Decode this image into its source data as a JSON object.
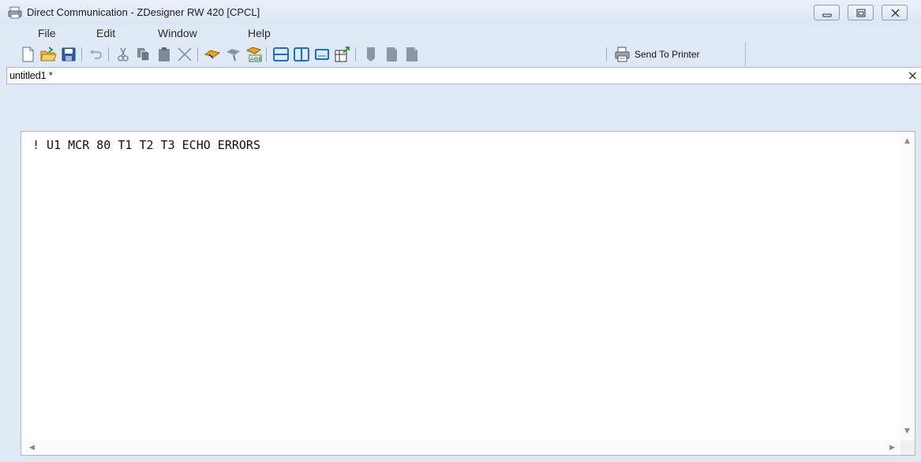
{
  "window": {
    "title": "Direct Communication - ZDesigner RW 420 [CPCL]"
  },
  "menu": {
    "items": [
      "File",
      "Edit",
      "Window",
      "Help"
    ]
  },
  "toolbar": {
    "icons": [
      "new-file-icon",
      "open-folder-icon",
      "save-icon",
      "undo-icon",
      "cut-icon",
      "copy-icon",
      "paste-icon",
      "delete-icon",
      "send-command-icon",
      "receive-icon",
      "abc-icon",
      "horizontal-split-icon",
      "vertical-split-icon",
      "single-view-icon",
      "export-icon",
      "align-top-icon",
      "align-bottom-icon",
      "align-page-icon",
      "printer-icon"
    ],
    "send_label": "Send To Printer"
  },
  "tab": {
    "label": "untitled1 *",
    "close_glyph": "×"
  },
  "editor": {
    "content": "! U1 MCR 80 T1 T2 T3 ECHO ERRORS"
  },
  "colors": {
    "window_bg": "#dfe9f5",
    "toolbar_icon_blue": "#1b6fc9",
    "toolbar_icon_gray": "#7d8a99"
  }
}
